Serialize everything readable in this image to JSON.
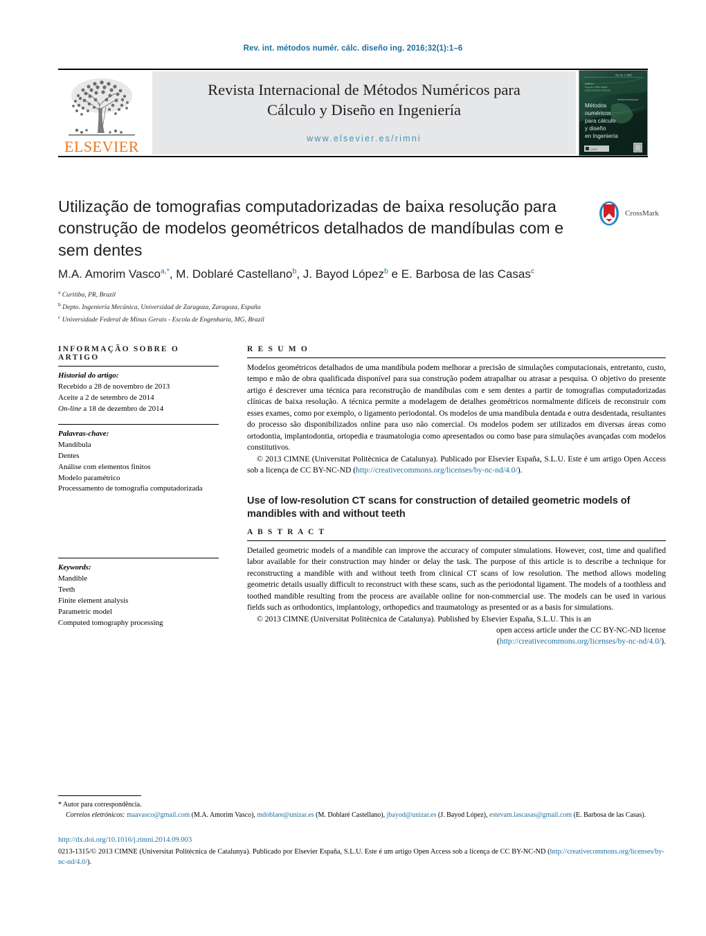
{
  "running_head": "Rev. int. métodos numér. cálc. diseño ing. 2016;32(1):1–6",
  "masthead": {
    "publisher_name": "ELSEVIER",
    "journal_title_line1": "Revista Internacional de Métodos Numéricos para",
    "journal_title_line2": "Cálculo y Diseño en Ingeniería",
    "journal_url": "www.elsevier.es/rimni",
    "cover_caption_lines": [
      "Métodos",
      "numéricos",
      "para cálculo",
      "y diseño",
      "en Ingeniería"
    ],
    "colors": {
      "elsevier_orange": "#E87722",
      "band_gray": "#e6e7e8",
      "link_blue": "#1a6fa3",
      "url_blue": "#4b8fb5"
    }
  },
  "crossmark": {
    "label": "CrossMark"
  },
  "article": {
    "title": "Utilização de tomografias computadorizadas de baixa resolução para construção de modelos geométricos detalhados de mandíbulas com e sem dentes",
    "authors_html": "M.A. Amorim Vasco<sup>a,*</sup>,  M. Doblaré Castellano<sup>b</sup>, J. Bayod López<sup>b</sup> e E. Barbosa de las Casas<sup>c</sup>",
    "affiliations": [
      {
        "marker": "a",
        "text": "Curitiba, PR, Brazil"
      },
      {
        "marker": "b",
        "text": "Depto. Ingeniería Mecánica, Universidad de Zaragoza, Zaragoza, España"
      },
      {
        "marker": "c",
        "text": "Universidade Federal de Minas Gerais - Escola de Engenharia, MG, Brazil"
      }
    ]
  },
  "info_column": {
    "heading": "INFORMAÇÃO SOBRE O ARTIGO",
    "history_label": "Historial do artigo:",
    "history": [
      "Recebido a 28 de novembro de 2013",
      "Aceite a 2 de setembro de 2014",
      "On-line a 18 de dezembro de 2014"
    ],
    "history_online_prefix": "On-line",
    "history_online_rest": " a 18 de dezembro de 2014",
    "keywords_pt_label": "Palavras-chave:",
    "keywords_pt": [
      "Mandíbula",
      "Dentes",
      "Análise com elementos finitos",
      "Modelo paramétrico",
      "Processamento de tomografia computadorizada"
    ],
    "keywords_en_label": "Keywords:",
    "keywords_en": [
      "Mandible",
      "Teeth",
      "Finite element analysis",
      "Parametric model",
      "Computed tomography processing"
    ]
  },
  "resumo": {
    "heading": "R E S U M O",
    "body": "Modelos geométricos detalhados de uma mandíbula podem melhorar a precisão de simulações computacionais, entretanto, custo, tempo e mão de obra qualificada disponível para sua construção podem atrapalhar ou atrasar a pesquisa. O objetivo do presente artigo é descrever uma técnica para reconstrução de mandíbulas com e sem dentes a partir de tomografias computadorizadas clínicas de baixa resolução. A técnica permite a modelagem de detalhes geométricos normalmente difíceis de reconstruir com esses exames, como por exemplo, o ligamento periodontal. Os modelos de uma mandíbula dentada e outra desdentada, resultantes do processo são disponibilizados online para uso não comercial. Os modelos podem ser utilizados em diversas áreas como ortodontia, implantodontia, ortopedia e traumatologia como apresentados ou como base para simulações avançadas com modelos constitutivos.",
    "copyright_text": "© 2013 CIMNE (Universitat Politècnica de Catalunya). Publicado por Elsevier España, S.L.U. Este é um artigo Open Access sob a licença de CC BY-NC-ND (",
    "copyright_link": "http://creativecommons.org/licenses/by-nc-nd/4.0/",
    "copyright_tail": ")."
  },
  "abstract": {
    "english_title": "Use of low-resolution CT scans for construction of detailed geometric models of mandibles with and without teeth",
    "heading": "A B S T R A C T",
    "body": "Detailed geometric models of a mandible can improve the accuracy of computer simulations. However, cost, time and qualified labor available for their construction may hinder or delay the task. The purpose of this article is to describe a technique for reconstructing a mandible with and without teeth from clinical CT scans of low resolution. The method allows modeling geometric details usually difficult to reconstruct with these scans, such as the periodontal ligament. The models of a toothless and toothed mandible resulting from the process are available online for non-commercial use. The models can be used in various fields such as orthodontics, implantology, orthopedics and traumatology as presented or as a basis for simulations.",
    "copyright_line1": "© 2013 CIMNE (Universitat Politècnica de Catalunya). Published by Elsevier España, S.L.U. This is an",
    "copyright_line2": "open access article under the CC BY-NC-ND license",
    "copyright_link_open": "(",
    "copyright_link": "http://creativecommons.org/licenses/by-nc-nd/4.0/",
    "copyright_tail": ")."
  },
  "footer": {
    "corresponding_marker": "*",
    "corresponding_text": "Autor para correspondência.",
    "emails_label": "Correios eletrónicos:",
    "emails": [
      {
        "address": "maavasco@gmail.com",
        "owner": "(M.A. Amorim Vasco),"
      },
      {
        "address": "mdoblare@unizar.es",
        "owner": "(M. Doblaré Castellano),"
      },
      {
        "address": "jbayod@unizar.es",
        "owner": "(J. Bayod López),"
      },
      {
        "address": "estevam.lascasas@gmail.com",
        "owner": "(E. Barbosa de las Casas)."
      }
    ],
    "doi": "http://dx.doi.org/10.1016/j.rimni.2014.09.003",
    "issn_copyright": "0213-1315/© 2013 CIMNE (Universitat Politècnica de Catalunya). Publicado por Elsevier España, S.L.U. Este é um artigo Open Access sob a licença de CC BY-NC-ND",
    "license_open": "(",
    "license_link": "http://creativecommons.org/licenses/by-nc-nd/4.0/",
    "license_tail": ")."
  }
}
